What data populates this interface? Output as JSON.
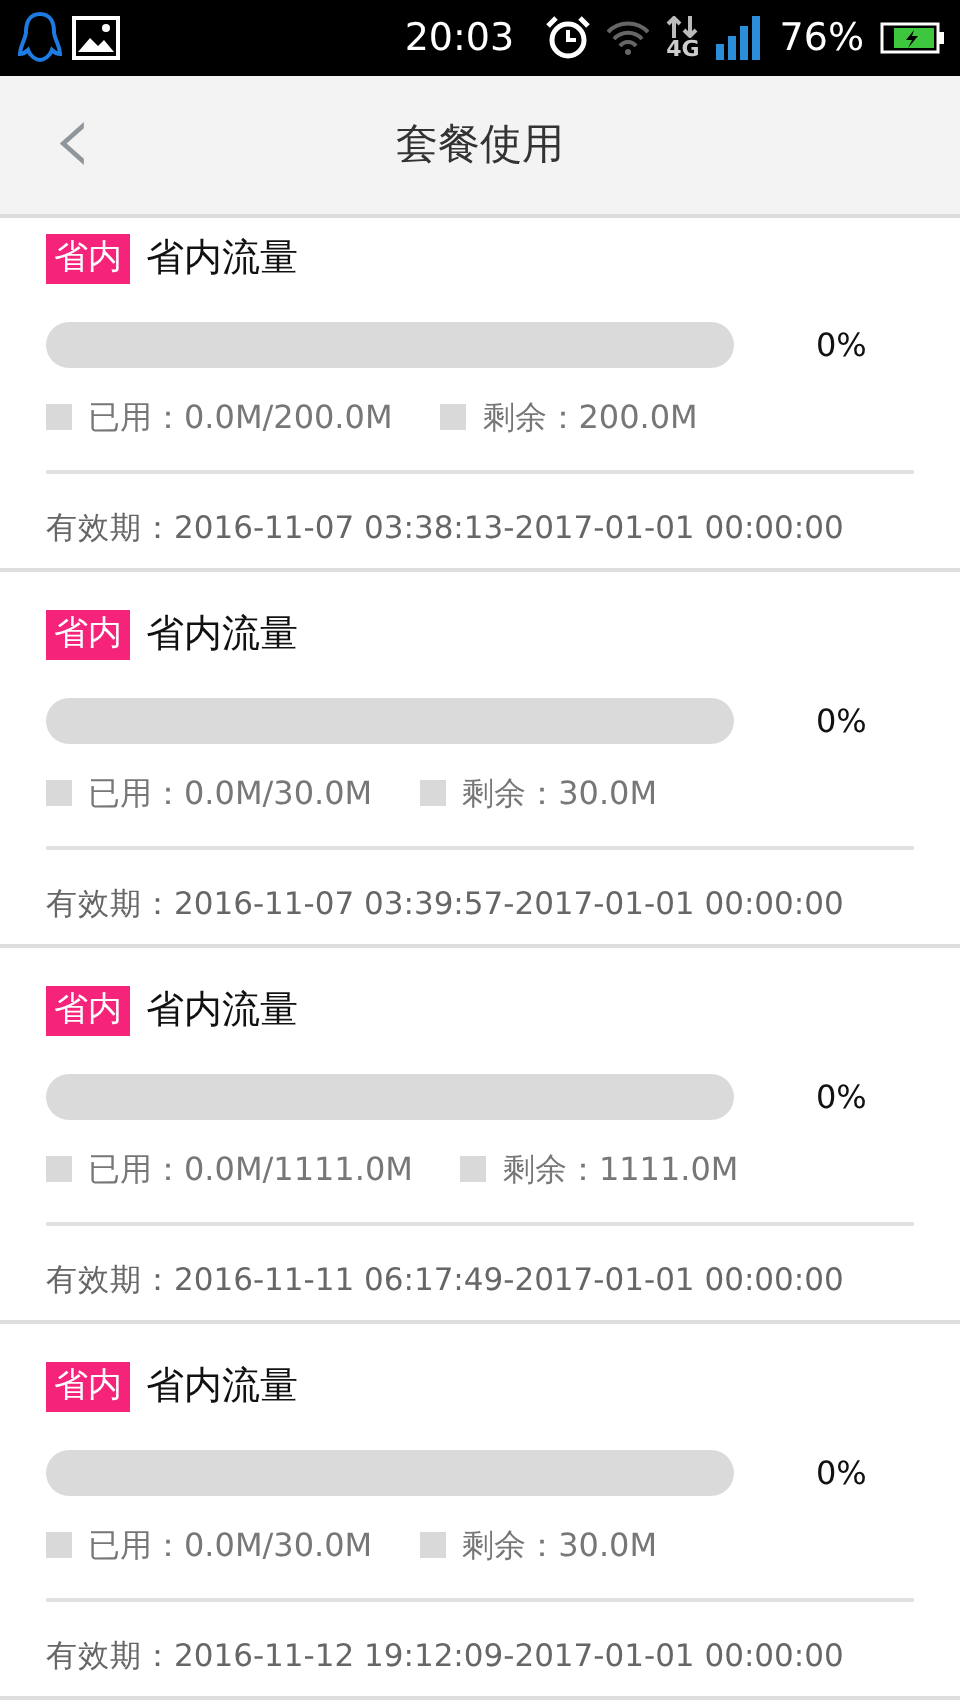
{
  "status_bar": {
    "time": "20:03",
    "network": "4G",
    "battery": "76%"
  },
  "header": {
    "back": "‹",
    "title": "套餐使用"
  },
  "packages": [
    {
      "tag": "省内",
      "name": "省内流量",
      "level": 0,
      "percent": "0%",
      "used": "已用：0.0M/200.0M",
      "remaining": "剩余：200.0M",
      "validity": "有效期：2016-11-07 03:38:13-2017-01-01 00:00:00"
    },
    {
      "tag": "省内",
      "name": "省内流量",
      "level": 0,
      "percent": "0%",
      "used": "已用：0.0M/30.0M",
      "remaining": "剩余：30.0M",
      "validity": "有效期：2016-11-07 03:39:57-2017-01-01 00:00:00"
    },
    {
      "tag": "省内",
      "name": "省内流量",
      "level": 0,
      "percent": "0%",
      "used": "已用：0.0M/1111.0M",
      "remaining": "剩余：1111.0M",
      "validity": "有效期：2016-11-11 06:17:49-2017-01-01 00:00:00"
    },
    {
      "tag": "省内",
      "name": "省内流量",
      "level": 0,
      "percent": "0%",
      "used": "已用：0.0M/30.0M",
      "remaining": "剩余：30.0M",
      "validity": "有效期：2016-11-12 19:12:09-2017-01-01 00:00:00"
    }
  ]
}
